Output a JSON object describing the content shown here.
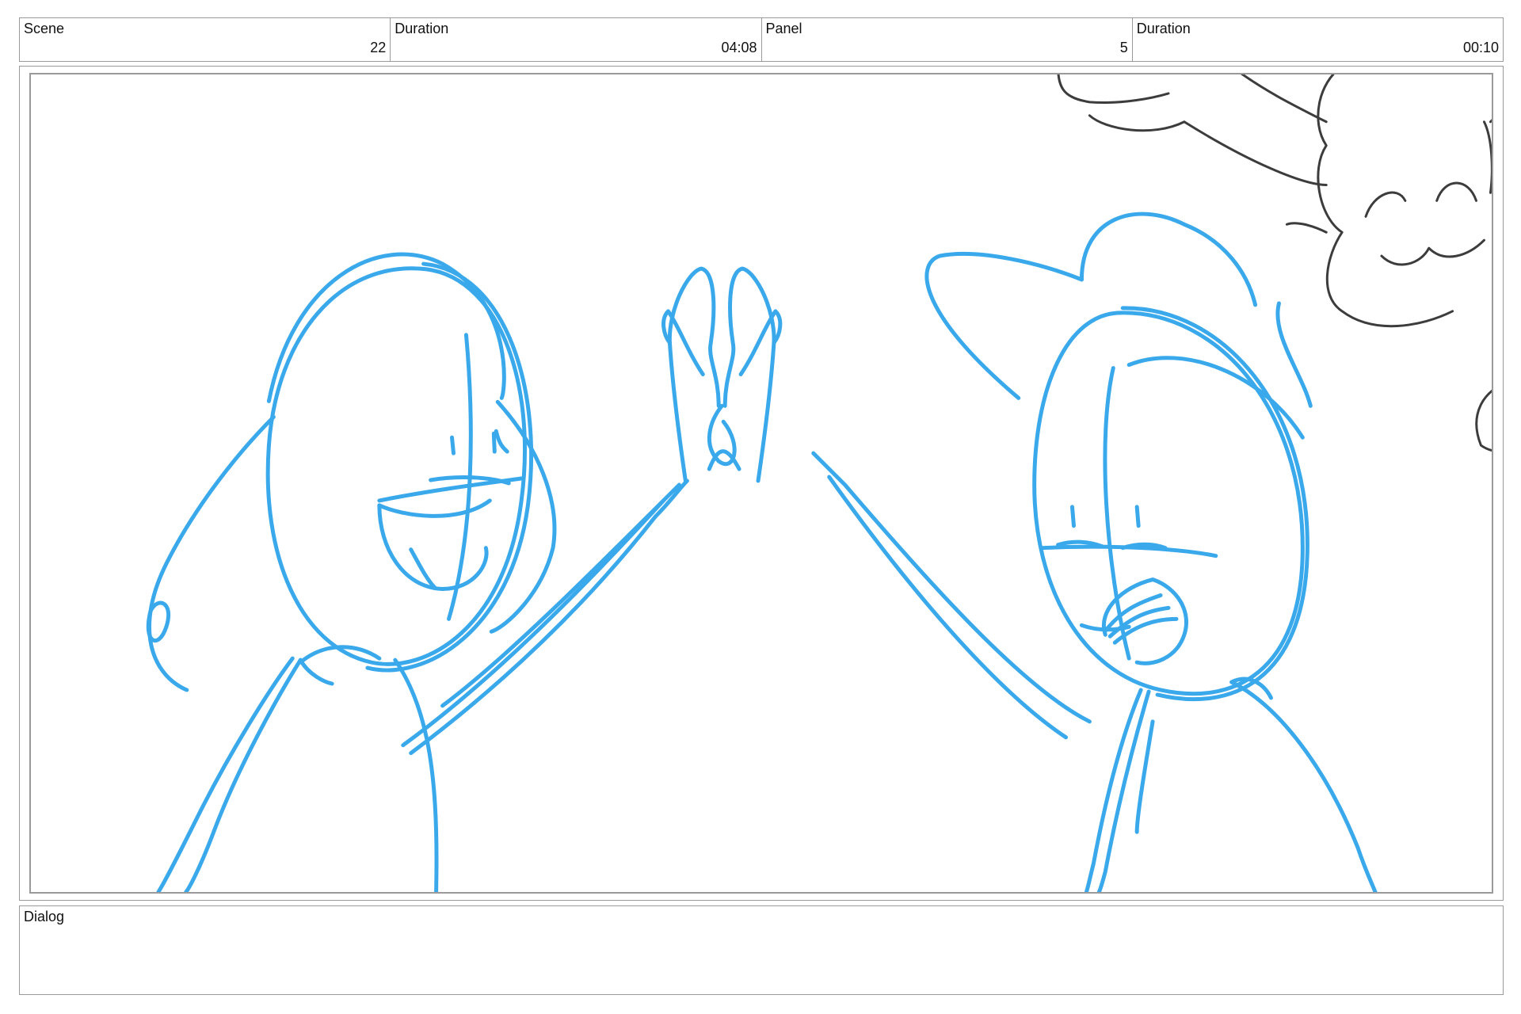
{
  "header": {
    "scene_label": "Scene",
    "scene_value": "22",
    "scene_duration_label": "Duration",
    "scene_duration_value": "04:08",
    "panel_label": "Panel",
    "panel_value": "5",
    "panel_duration_label": "Duration",
    "panel_duration_value": "00:10"
  },
  "dialog": {
    "label": "Dialog",
    "text": ""
  },
  "colors": {
    "sketch_blue": "#3aa9ec",
    "sketch_gray": "#3c3c3c",
    "border": "#9a9a9a"
  }
}
